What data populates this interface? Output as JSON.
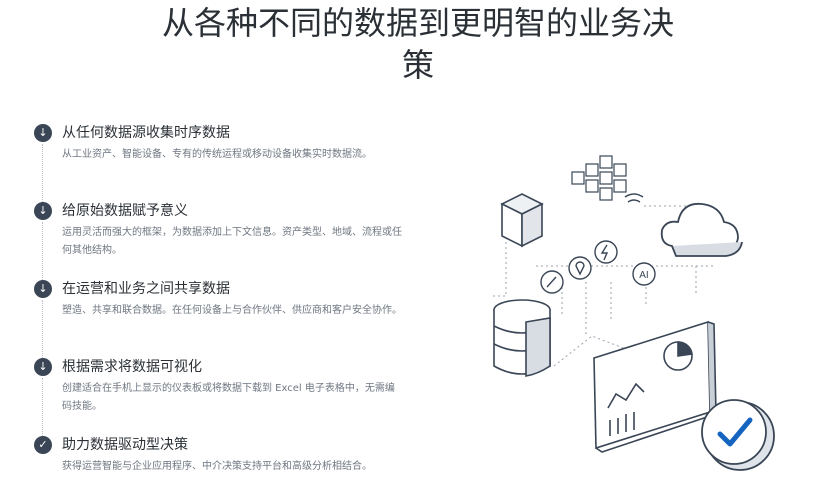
{
  "title": {
    "line1": "从各种不同的数据到更明智的业务决",
    "line2": "策"
  },
  "steps": [
    {
      "icon": "arrow-down-icon",
      "heading": "从任何数据源收集时序数据",
      "desc": "从工业资产、智能设备、专有的传统运程或移动设备收集实时数据流。"
    },
    {
      "icon": "arrow-down-icon",
      "heading": "给原始数据赋予意义",
      "desc": "运用灵活而强大的框架，为数据添加上下文信息。资产类型、地域、流程或任何其他结构。"
    },
    {
      "icon": "arrow-down-icon",
      "heading": "在运营和业务之间共享数据",
      "desc": "塑造、共享和联合数据。在任何设备上与合作伙伴、供应商和客户安全协作。"
    },
    {
      "icon": "arrow-down-icon",
      "heading": "根据需求将数据可视化",
      "desc": "创建适合在手机上显示的仪表板或将数据下载到 Excel 电子表格中，无需编码技能。"
    },
    {
      "icon": "checkmark-icon",
      "heading": "助力数据驱动型决策",
      "desc": "获得运营智能与企业应用程序、中介决策支持平台和高级分析相结合。"
    }
  ],
  "illustration": {
    "ai_label": "AI"
  },
  "colors": {
    "dark": "#3a4656",
    "accent": "#1565c0",
    "muted": "#6f7782"
  }
}
